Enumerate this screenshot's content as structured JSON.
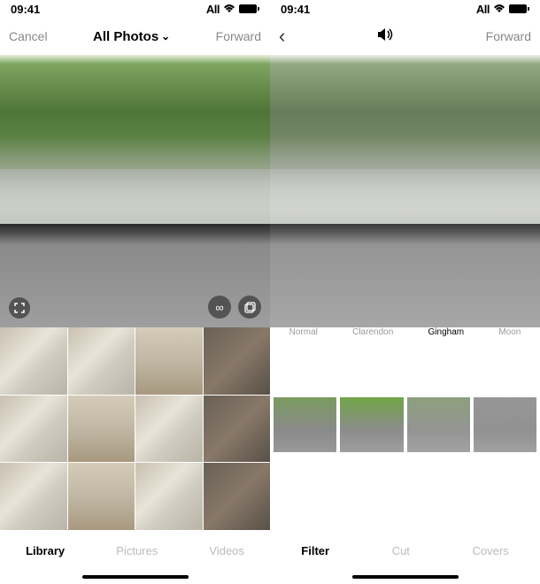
{
  "status": {
    "time": "09:41",
    "carrier": "All",
    "wifi_icon": "wifi",
    "battery_icon": "battery-full"
  },
  "left_panel": {
    "nav": {
      "cancel": "Cancel",
      "title": "All Photos",
      "chevron": "⌄",
      "forward": "Forward"
    },
    "overlay": {
      "expand_icon": "expand",
      "infinity_icon": "∞",
      "select_icon": "select"
    },
    "tabs": {
      "library": "Library",
      "pictures": "Pictures",
      "videos": "Videos"
    }
  },
  "right_panel": {
    "nav": {
      "back_icon": "chevron-left",
      "sound_icon": "volume",
      "forward": "Forward"
    },
    "filter_names": {
      "normal": "Normal",
      "clarendon": "Clarendon",
      "gingham": "Gingham",
      "moon": "Moon"
    },
    "tabs": {
      "filter": "Filter",
      "cut": "Cut",
      "covers": "Covers"
    }
  }
}
